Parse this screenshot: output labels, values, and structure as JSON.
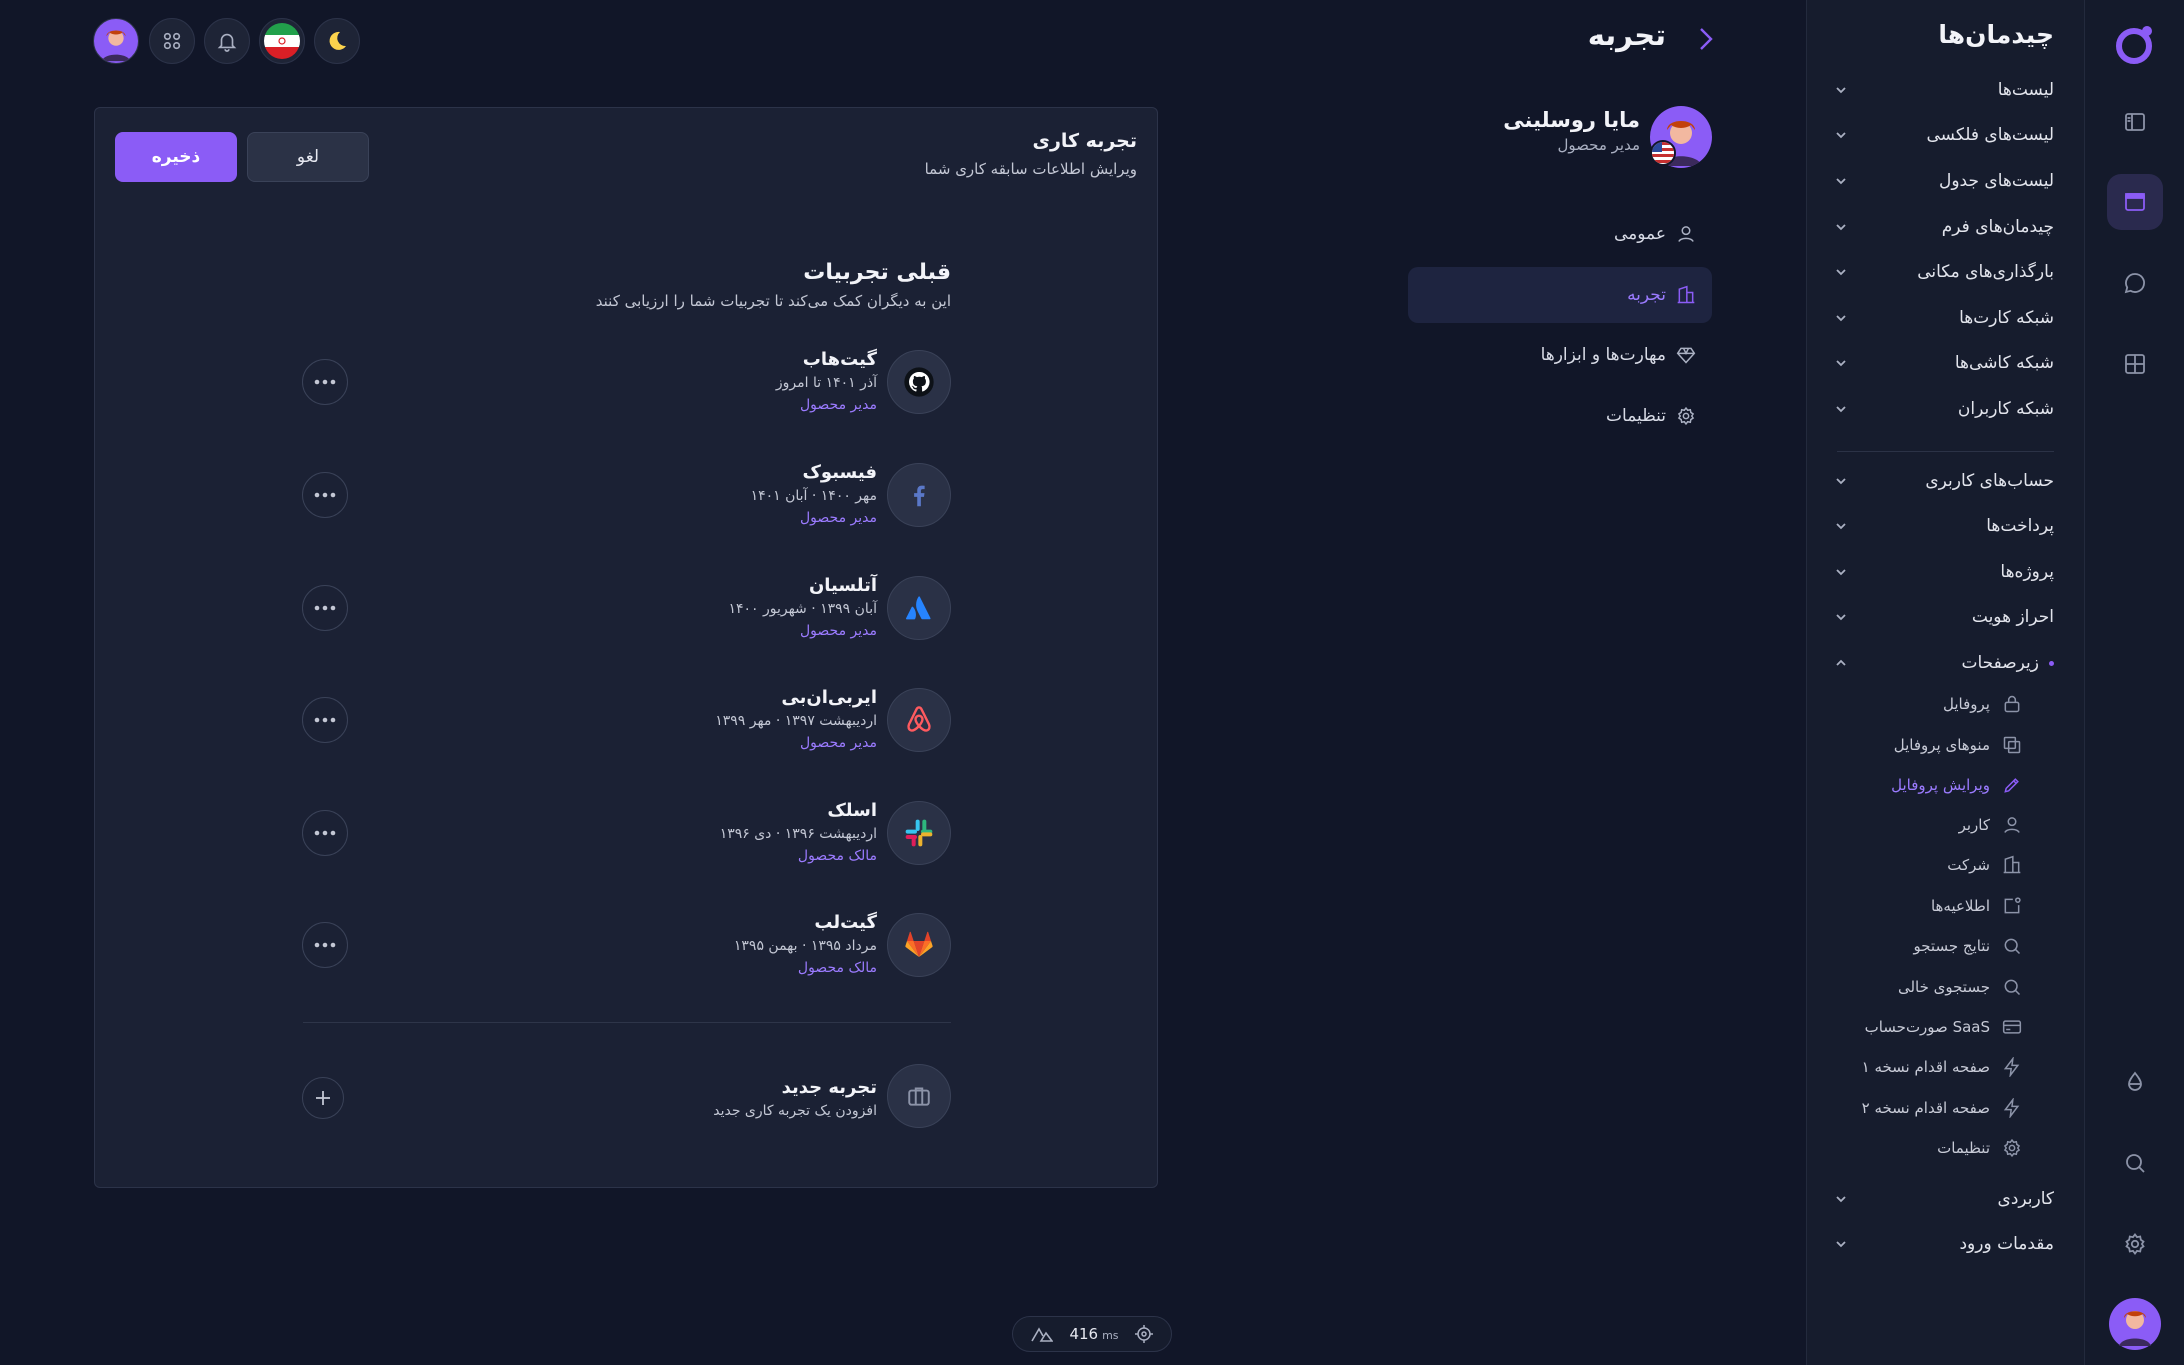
{
  "header": {
    "title": "تجربه"
  },
  "sidebar": {
    "title": "چیدمان‌ها",
    "groups": [
      {
        "label": "لیست‌ها"
      },
      {
        "label": "لیست‌های فلکسی"
      },
      {
        "label": "لیست‌های جدول"
      },
      {
        "label": "چیدمان‌های فرم"
      },
      {
        "label": "بارگذاری‌های مکانی"
      },
      {
        "label": "شبکه کارت‌ها"
      },
      {
        "label": "شبکه کاشی‌ها"
      },
      {
        "label": "شبکه کاربران"
      },
      {
        "label": "حساب‌های کاربری"
      },
      {
        "label": "پرداخت‌ها"
      },
      {
        "label": "پروژه‌ها"
      },
      {
        "label": "احراز هویت"
      },
      {
        "label": "زیرصفحات"
      },
      {
        "label": "کاربردی"
      },
      {
        "label": "مقدمات ورود"
      }
    ],
    "subpages": [
      {
        "label": "پروفایل",
        "icon": "lock-icon"
      },
      {
        "label": "منوهای پروفایل",
        "icon": "copy-icon"
      },
      {
        "label": "ویرایش پروفایل",
        "icon": "pencil-icon"
      },
      {
        "label": "کاربر",
        "icon": "user-icon"
      },
      {
        "label": "شرکت",
        "icon": "building-icon"
      },
      {
        "label": "اطلاعیه‌ها",
        "icon": "notification-icon"
      },
      {
        "label": "نتایج جستجو",
        "icon": "search-icon"
      },
      {
        "label": "جستجوی خالی",
        "icon": "search-icon"
      },
      {
        "label": "صورت‌حساب SaaS",
        "icon": "card-icon"
      },
      {
        "label": "صفحه اقدام نسخه ۱",
        "icon": "bolt-icon"
      },
      {
        "label": "صفحه اقدام نسخه ۲",
        "icon": "bolt-icon"
      },
      {
        "label": "تنظیمات",
        "icon": "gear-icon"
      }
    ]
  },
  "profile": {
    "name": "مایا روسلینی",
    "role": "مدیر محصول",
    "nav": [
      {
        "label": "عمومی",
        "icon": "user-icon"
      },
      {
        "label": "تجربه",
        "icon": "building-icon"
      },
      {
        "label": "مهارت‌ها و ابزارها",
        "icon": "diamond-icon"
      },
      {
        "label": "تنظیمات",
        "icon": "gear-icon"
      }
    ]
  },
  "card": {
    "title": "تجربه کاری",
    "subtitle": "ویرایش اطلاعات سابقه کاری شما",
    "cancel_label": "لغو",
    "save_label": "ذخیره",
    "section_title": "قبلی تجربیات",
    "section_subtitle": "این به دیگران کمک می‌کند تا تجربیات شما را ارزیابی کنند",
    "experiences": [
      {
        "company": "گیت‌هاب",
        "period": "آذر ۱۴۰۱ تا امروز",
        "role": "مدیر محصول",
        "logo": "github-icon"
      },
      {
        "company": "فیسبوک",
        "period": "مهر ۱۴۰۰ · آبان ۱۴۰۱",
        "role": "مدیر محصول",
        "logo": "facebook-icon"
      },
      {
        "company": "آتلسیان",
        "period": "آبان ۱۳۹۹ · شهریور ۱۴۰۰",
        "role": "مدیر محصول",
        "logo": "atlassian-icon"
      },
      {
        "company": "ایربی‌ان‌بی",
        "period": "اردیبهشت ۱۳۹۷ · مهر ۱۳۹۹",
        "role": "مدیر محصول",
        "logo": "airbnb-icon"
      },
      {
        "company": "اسلک",
        "period": "اردیبهشت ۱۳۹۶ · دی ۱۳۹۶",
        "role": "مالک محصول",
        "logo": "slack-icon"
      },
      {
        "company": "گیت‌لب",
        "period": "مرداد ۱۳۹۵ · بهمن ۱۳۹۵",
        "role": "مالک محصول",
        "logo": "gitlab-icon"
      }
    ],
    "new_title": "تجربه جدید",
    "new_subtitle": "افزودن یک تجربه کاری جدید"
  },
  "perf": {
    "value": "416",
    "unit": "ms"
  },
  "colors": {
    "accent": "#8b5cf6",
    "background": "#111628",
    "card": "#1b2134"
  }
}
